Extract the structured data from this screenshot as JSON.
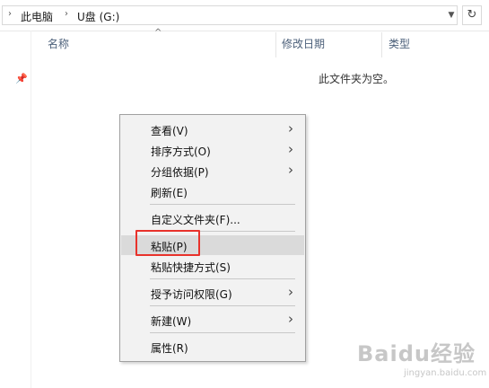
{
  "address_bar": {
    "breadcrumbs": [
      "此电脑",
      "U盘 (G:)"
    ],
    "refresh_icon": "refresh-icon",
    "dropdown_icon": "chevron-down-icon"
  },
  "columns": {
    "name": "名称",
    "date_modified": "修改日期",
    "type": "类型"
  },
  "empty_message": "此文件夹为空。",
  "context_menu": {
    "items": [
      {
        "label": "查看(V)",
        "submenu": true
      },
      {
        "label": "排序方式(O)",
        "submenu": true
      },
      {
        "label": "分组依据(P)",
        "submenu": true
      },
      {
        "label": "刷新(E)",
        "submenu": false
      },
      {
        "label": "自定义文件夹(F)...",
        "submenu": false
      },
      {
        "label": "粘贴(P)",
        "submenu": false,
        "highlighted": true
      },
      {
        "label": "粘贴快捷方式(S)",
        "submenu": false
      },
      {
        "label": "授予访问权限(G)",
        "submenu": true
      },
      {
        "label": "新建(W)",
        "submenu": true
      },
      {
        "label": "属性(R)",
        "submenu": false
      }
    ]
  },
  "watermark": {
    "logo": "Baidu经验",
    "url": "jingyan.baidu.com"
  },
  "colors": {
    "highlight_box": "#e8322b",
    "menu_background": "#f2f2f2",
    "hover_row": "#dadada"
  }
}
